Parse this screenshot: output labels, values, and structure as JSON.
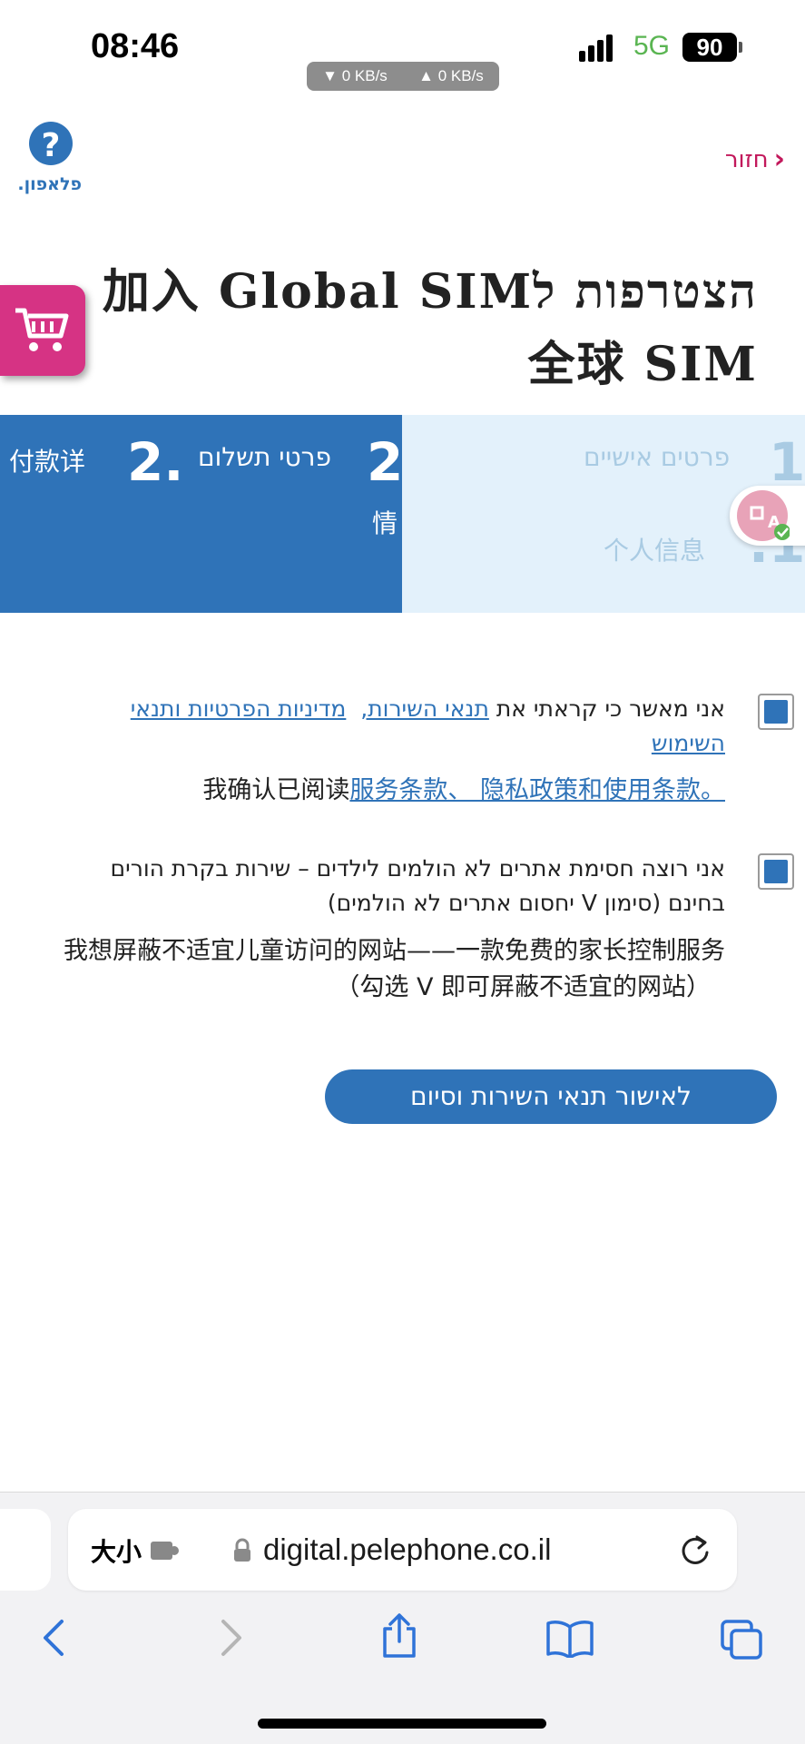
{
  "status_bar": {
    "time": "08:46",
    "network": "5G",
    "battery": "90",
    "down_speed": "▼ 0 KB/s",
    "up_speed": "▲ 0 KB/s"
  },
  "header": {
    "logo_text": "פלאפון.",
    "back_label": "חזור"
  },
  "title": {
    "line1": "הצטרפות ל加入 Global SIM",
    "line2": "全球 SIM"
  },
  "steps": {
    "payment": {
      "number": "2",
      "label_he": "פרטי תשלום",
      "number_zh": "2.",
      "label_zh": "付款详",
      "label_zh_cont": "情"
    },
    "personal": {
      "number": "1",
      "label_he": "פרטים אישיים",
      "label_zh": "个人信息",
      "number_zh": ".1"
    }
  },
  "agreements": {
    "terms": {
      "prefix_he": "אני מאשר כי קראתי את ",
      "link1_he": "תנאי השירות,",
      "link2_he": "מדיניות הפרטיות ותנאי השימוש",
      "zh_prefix": "我确认已阅读",
      "zh_link": "服务条款、 隐私政策和使用条款",
      "zh_suffix": "。"
    },
    "parental": {
      "text_he_line1": "אני רוצה חסימת אתרים לא הולמים לילדים – שירות בקרת הורים",
      "text_he_line2": "בחינם (סימון V יחסום אתרים לא הולמים)",
      "zh_line1": "我想屏蔽不适宜儿童访问的网站——一款免费的家长控制服务",
      "zh_line2": "（勾选 V 即可屏蔽不适宜的网站）"
    }
  },
  "cta": {
    "label": "לאישור תנאי השירות וסיום"
  },
  "browser": {
    "size_label": "大小",
    "url": "digital.pelephone.co.il"
  },
  "colors": {
    "primary": "#2f73b8",
    "accent": "#c2185b",
    "cart": "#d63384"
  }
}
